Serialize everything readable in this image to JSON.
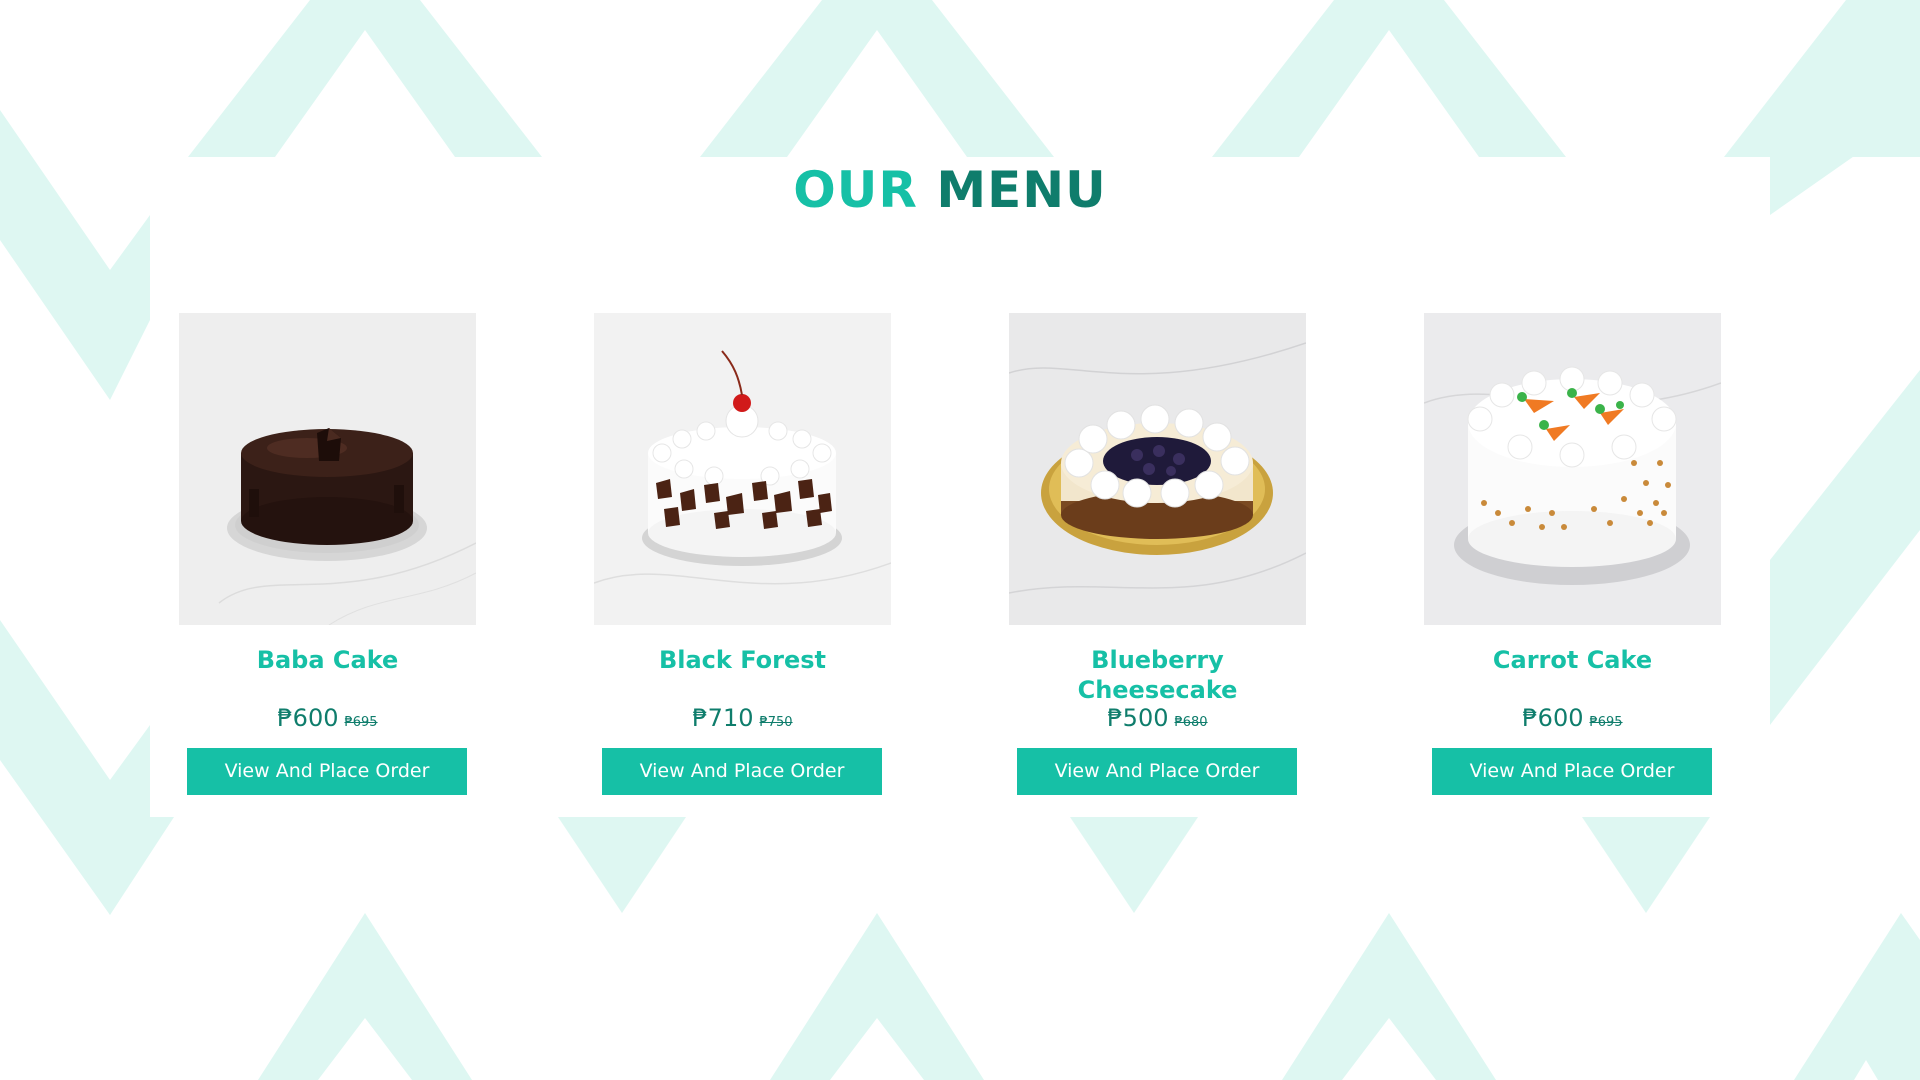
{
  "heading": {
    "word1": "OUR",
    "word2": "MENU"
  },
  "colors": {
    "accent": "#16c0a6",
    "accent_dark": "#0f7d6c",
    "background_pattern": "#def7f2",
    "button_text": "#ffffff"
  },
  "products": [
    {
      "name": "Baba Cake",
      "price": "₱600",
      "old_price": "₱695",
      "button_label": "View And Place Order",
      "image_icon": "chocolate-cake-image"
    },
    {
      "name": "Black Forest",
      "price": "₱710",
      "old_price": "₱750",
      "button_label": "View And Place Order",
      "image_icon": "black-forest-cake-image"
    },
    {
      "name": "Blueberry Cheesecake",
      "price": "₱500",
      "old_price": "₱680",
      "button_label": "View And Place Order",
      "image_icon": "blueberry-cheesecake-image"
    },
    {
      "name": "Carrot Cake",
      "price": "₱600",
      "old_price": "₱695",
      "button_label": "View And Place Order",
      "image_icon": "carrot-cake-image"
    }
  ]
}
